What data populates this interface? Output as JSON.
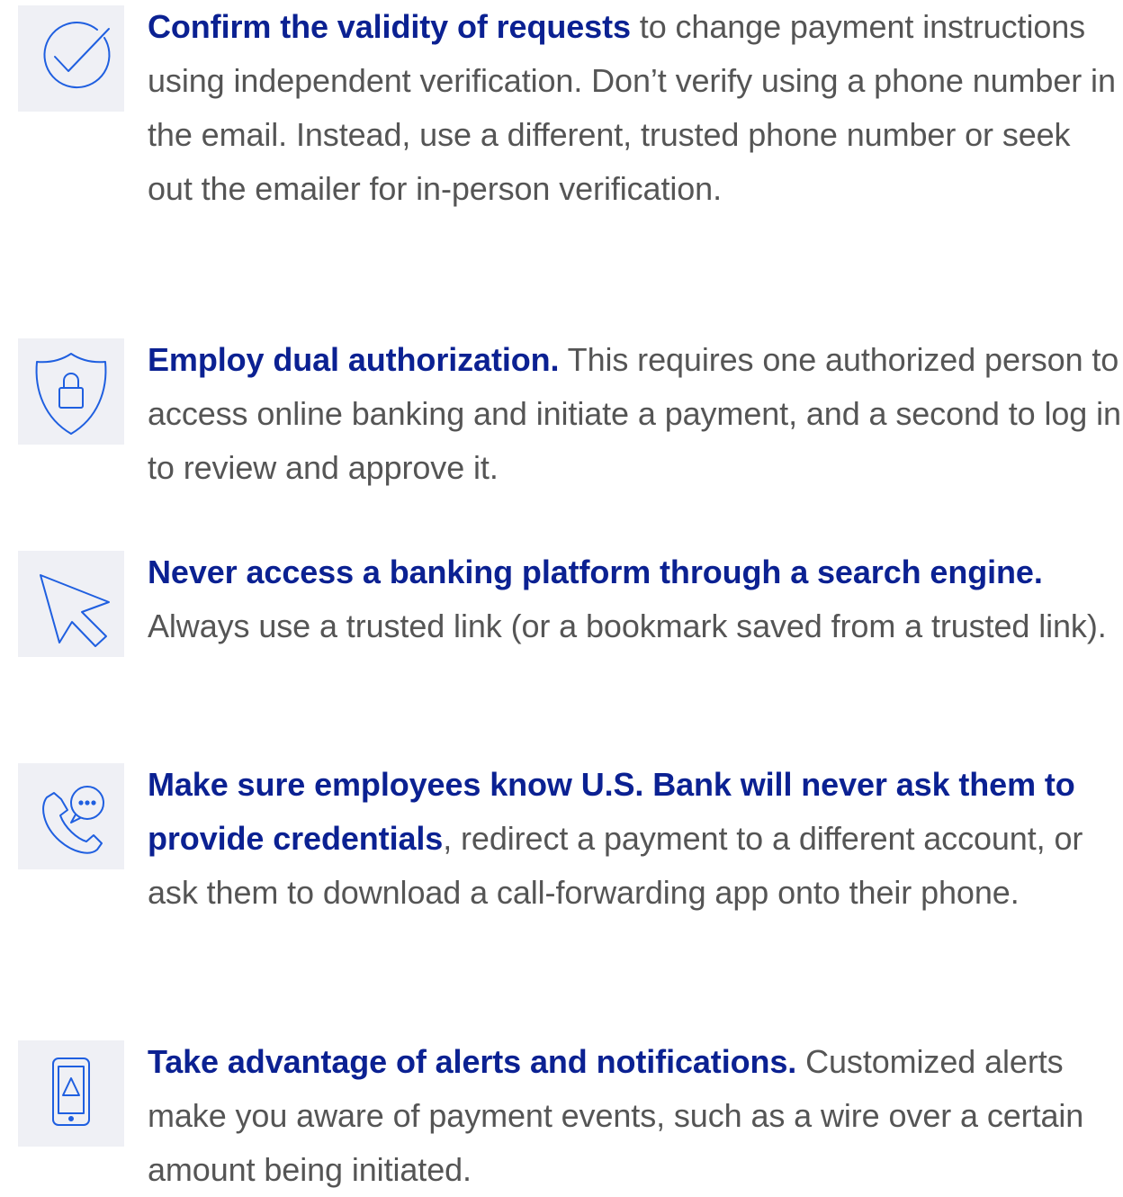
{
  "colors": {
    "accent": "#0b2192",
    "body_text": "#555555",
    "icon_stroke": "#1f5fe0",
    "icon_box": "#eff0f5"
  },
  "tips": [
    {
      "icon": "checkmark-circle-icon",
      "bold": "Confirm the validity of requests",
      "text": " to change payment instructions using independent verification. Don’t verify using a phone number in the email. Instead, use a different, trusted phone number or seek out the emailer for in-person verification."
    },
    {
      "icon": "shield-lock-icon",
      "bold": "Employ dual authorization.",
      "text": " This requires one authorized person to access online banking and initiate a payment, and a second to log in to review and approve it."
    },
    {
      "icon": "cursor-arrow-icon",
      "bold": "Never access a banking platform through a search engine.",
      "text": " Always use a trusted link (or a bookmark saved from a trusted link)."
    },
    {
      "icon": "phone-chat-icon",
      "bold": "Make sure employees know U.S. Bank will never ask them to provide credentials",
      "text": ", redirect a payment to a different account, or ask them to download a call-forwarding app onto their phone."
    },
    {
      "icon": "mobile-alert-icon",
      "bold": "Take advantage of alerts and notifications.",
      "text": " Customized alerts make you aware of payment events, such as a wire over a certain amount being initiated."
    }
  ]
}
